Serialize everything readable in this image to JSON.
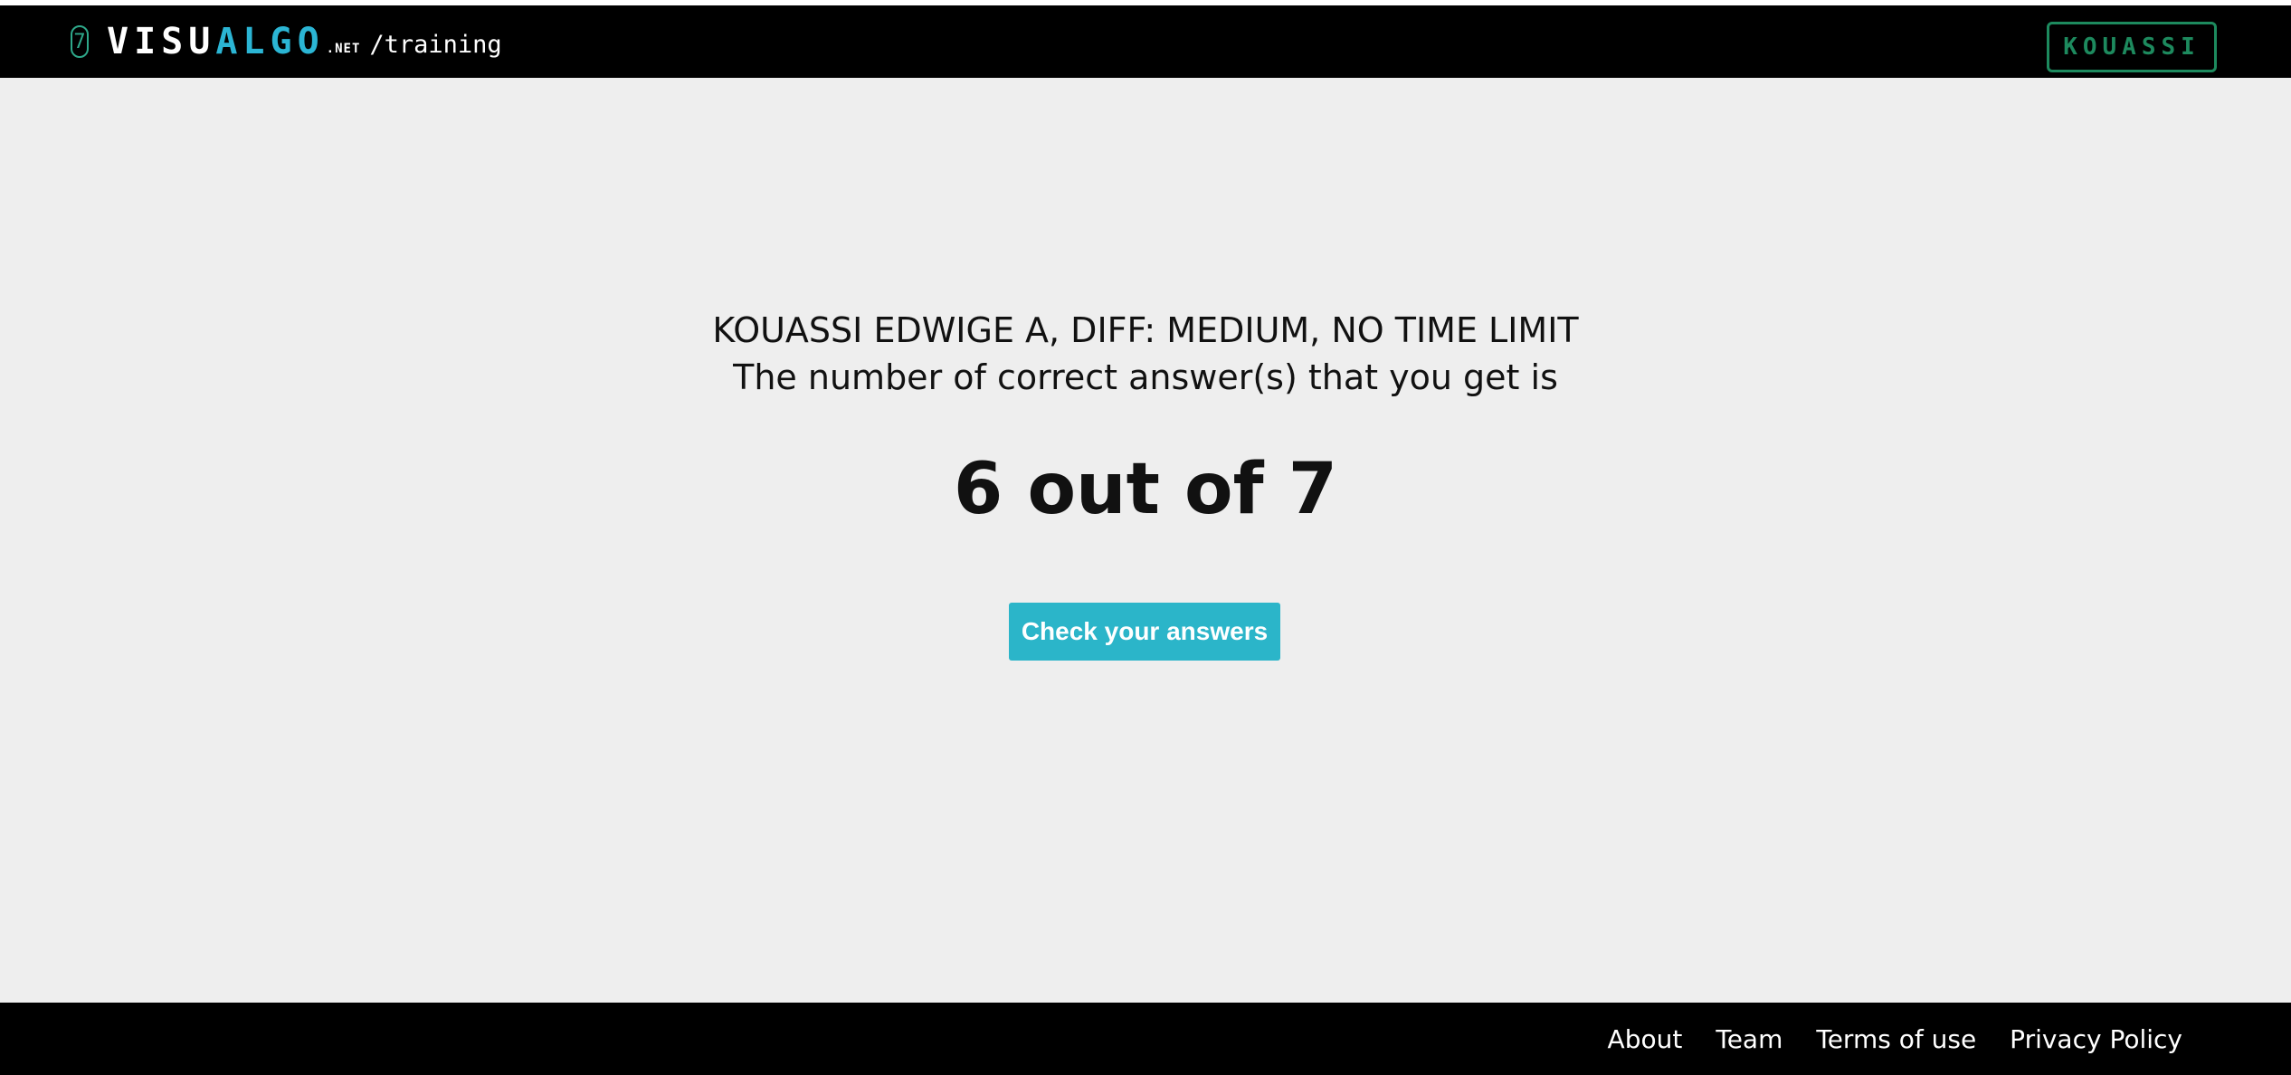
{
  "header": {
    "logo_badge": "7",
    "logo_visu": "VISU",
    "logo_algo": "ALGO",
    "logo_net": ".NET",
    "logo_path": "/training",
    "user_button_label": "KOUASSI",
    "colors": {
      "background": "#000000",
      "logo_accent": "#2bb5d4",
      "user_button": "#1d8a5e"
    }
  },
  "result": {
    "header_line": "KOUASSI EDWIGE A, DIFF: MEDIUM, NO TIME LIMIT",
    "subtitle": "The number of correct answer(s) that you get is",
    "score": "6 out of 7",
    "check_button_label": "Check your answers",
    "button_color": "#2bb5c9"
  },
  "footer": {
    "links": [
      {
        "label": "About"
      },
      {
        "label": "Team"
      },
      {
        "label": "Terms of use"
      },
      {
        "label": "Privacy Policy"
      }
    ]
  }
}
